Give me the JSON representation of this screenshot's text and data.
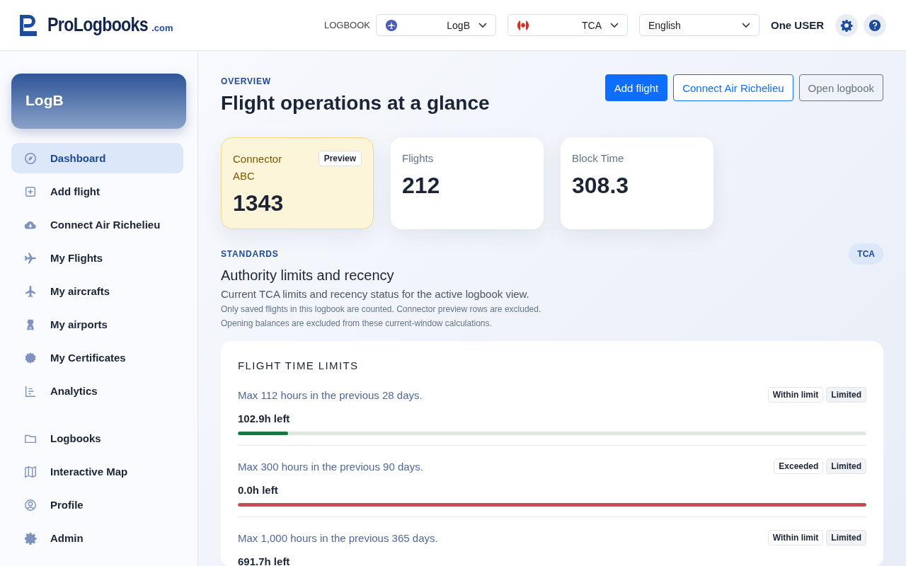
{
  "header": {
    "brand": "ProLogbooks",
    "brand_suffix": ".com",
    "logbook_label": "LOGBOOK",
    "logbook_select": {
      "value": "LogB"
    },
    "authority_select": {
      "value": "TCA"
    },
    "language_select": {
      "value": "English"
    },
    "user": "One USER"
  },
  "sidebar": {
    "logbook_card": "LogB",
    "items": [
      {
        "label": "Dashboard",
        "selected": true
      },
      {
        "label": "Add flight",
        "selected": false
      },
      {
        "label": "Connect Air Richelieu",
        "selected": false
      },
      {
        "label": "My Flights",
        "selected": false
      },
      {
        "label": "My aircrafts",
        "selected": false
      },
      {
        "label": "My airports",
        "selected": false
      },
      {
        "label": "My Certificates",
        "selected": false
      },
      {
        "label": "Analytics",
        "selected": false
      }
    ],
    "secondary_items": [
      {
        "label": "Logbooks",
        "selected": false
      },
      {
        "label": "Interactive Map",
        "selected": false
      },
      {
        "label": "Profile",
        "selected": false
      },
      {
        "label": "Admin",
        "selected": false
      }
    ]
  },
  "overview": {
    "eyebrow": "OVERVIEW",
    "title": "Flight operations at a glance",
    "buttons": [
      {
        "label": "Add flight",
        "kind": "primary"
      },
      {
        "label": "Connect Air Richelieu",
        "kind": "outline"
      },
      {
        "label": "Open logbook",
        "kind": "secondary"
      }
    ]
  },
  "stats": [
    {
      "kind": "connector",
      "label": "Connector ABC",
      "badge": "Preview",
      "value": "1343"
    },
    {
      "kind": "metric",
      "label": "Flights",
      "value": "212"
    },
    {
      "kind": "metric",
      "label": "Block Time",
      "value": "308.3"
    }
  ],
  "standards": {
    "eyebrow": "STANDARDS",
    "title": "Authority limits and recency",
    "badge": "TCA",
    "subtitle": "Current TCA limits and recency status for the active logbook view.",
    "notes": [
      "Only saved flights in this logbook are counted. Connector preview rows are excluded.",
      "Opening balances are excluded from these current-window calculations."
    ]
  },
  "flight_time_limits": {
    "title": "FLIGHT TIME LIMITS",
    "rows": [
      {
        "rule": "Max 112 hours in the previous 28 days.",
        "status": "Within limit",
        "type": "Limited",
        "remaining": "102.9h left",
        "exceeded": false,
        "level": 0.08
      },
      {
        "rule": "Max 300 hours in the previous 90 days.",
        "status": "Exceeded",
        "type": "Limited",
        "remaining": "0.0h left",
        "exceeded": true,
        "level": 1
      },
      {
        "rule": "Max 1,000 hours in the previous 365 days.",
        "status": "Within limit",
        "type": "Limited",
        "remaining": "691.7h left"
      }
    ]
  }
}
